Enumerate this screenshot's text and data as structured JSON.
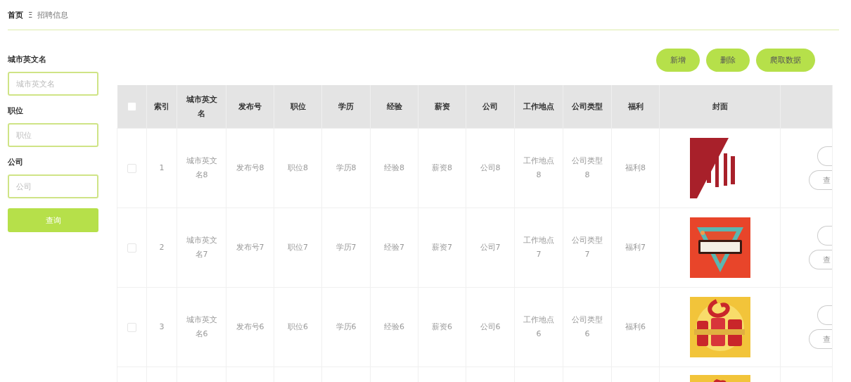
{
  "breadcrumb": {
    "items": [
      {
        "label": "首页",
        "current": false
      },
      {
        "label": "招聘信息",
        "current": true
      }
    ],
    "separator": "Ξ"
  },
  "filters": [
    {
      "label": "城市英文名",
      "placeholder": "城市英文名"
    },
    {
      "label": "职位",
      "placeholder": "职位"
    },
    {
      "label": "公司",
      "placeholder": "公司"
    }
  ],
  "search_button": "查询",
  "toolbar": [
    "新增",
    "删除",
    "爬取数据"
  ],
  "table": {
    "header_checkbox": {
      "checked": false
    },
    "columns": [
      "索引",
      "城市英文名",
      "发布号",
      "职位",
      "学历",
      "经验",
      "薪资",
      "公司",
      "工作地点",
      "公司类型",
      "福利",
      "封面"
    ],
    "rows": [
      {
        "selected": false,
        "cells": [
          "1",
          "城市英文名8",
          "发布号8",
          "职位8",
          "学历8",
          "经验8",
          "薪资8",
          "公司8",
          "工作地点8",
          "公司类型8",
          "福利8"
        ],
        "cover": {
          "kind": "picture"
        },
        "actions": [
          {
            "kind": "blank"
          },
          {
            "kind": "text",
            "label": "查"
          }
        ]
      },
      {
        "selected": false,
        "cells": [
          "2",
          "城市英文名7",
          "发布号7",
          "职位7",
          "学历7",
          "经验7",
          "薪资7",
          "公司7",
          "工作地点7",
          "公司类型7",
          "福利7"
        ],
        "cover": {
          "kind": "picture"
        },
        "actions": [
          {
            "kind": "blank"
          },
          {
            "kind": "text",
            "label": "查"
          }
        ]
      },
      {
        "selected": false,
        "cells": [
          "3",
          "城市英文名6",
          "发布号6",
          "职位6",
          "学历6",
          "经验6",
          "薪资6",
          "公司6",
          "工作地点6",
          "公司类型6",
          "福利6"
        ],
        "cover": {
          "kind": "picture"
        },
        "actions": [
          {
            "kind": "blank"
          },
          {
            "kind": "text",
            "label": "查"
          }
        ]
      },
      {
        "cover": {
          "kind": "picture"
        }
      }
    ]
  }
}
